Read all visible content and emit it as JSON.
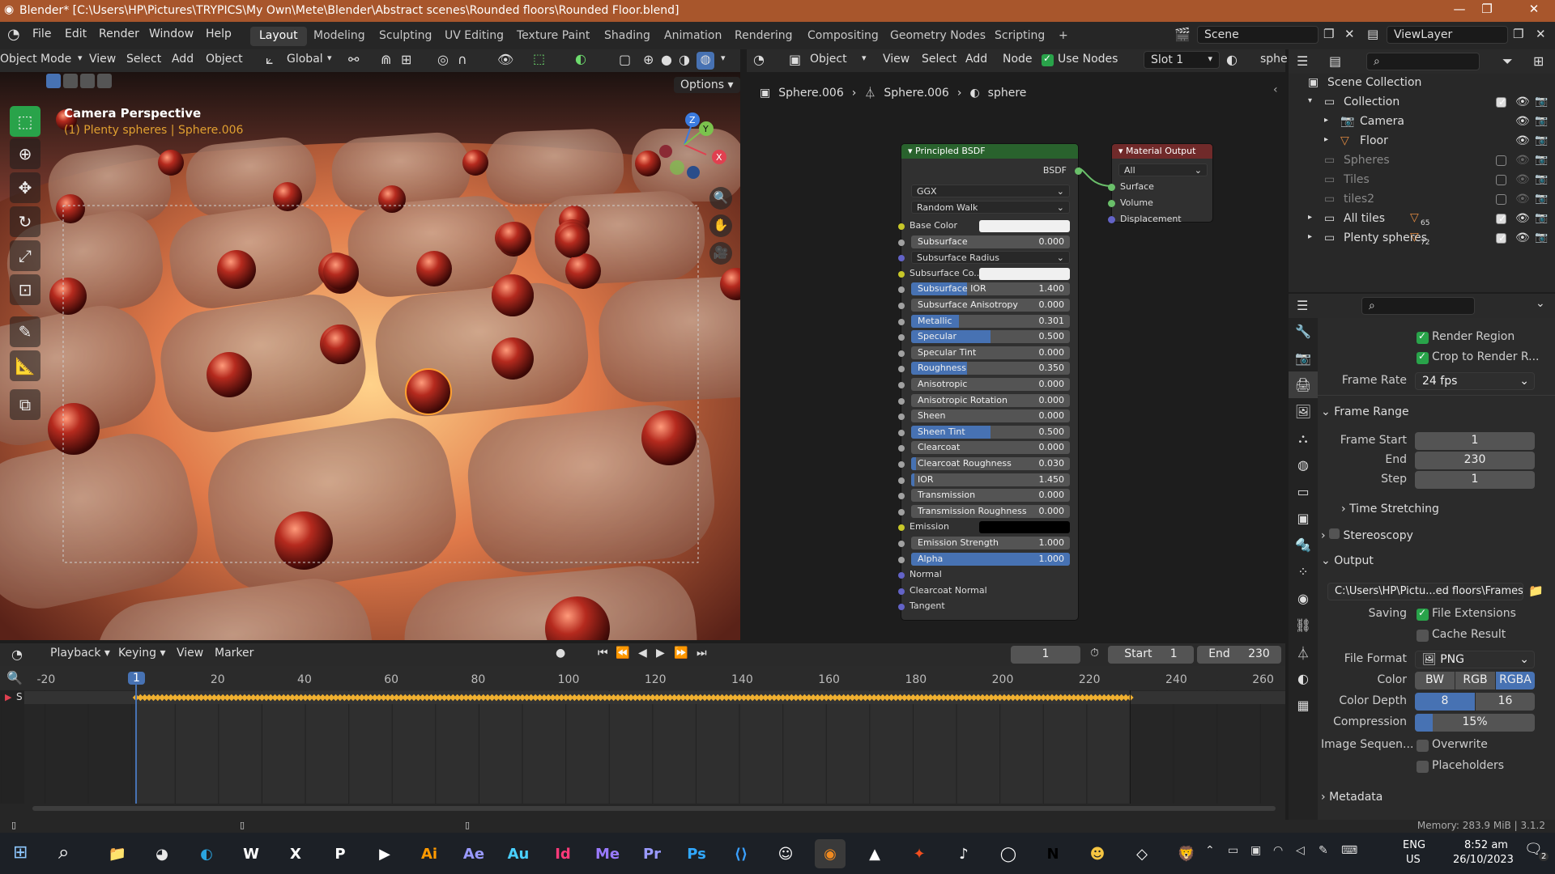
{
  "titlebar": {
    "title": "Blender* [C:\\Users\\HP\\Pictures\\TRYPICS\\My Own\\Mete\\Blender\\Abstract scenes\\Rounded floors\\Rounded Floor.blend]",
    "minimize": "—",
    "maximize": "❐",
    "close": "✕"
  },
  "menu": [
    "File",
    "Edit",
    "Render",
    "Window",
    "Help"
  ],
  "workspaces": [
    "Layout",
    "Modeling",
    "Sculpting",
    "UV Editing",
    "Texture Paint",
    "Shading",
    "Animation",
    "Rendering",
    "Compositing",
    "Geometry Nodes",
    "Scripting",
    "+"
  ],
  "scene_name": "Scene",
  "view_layer": "ViewLayer",
  "viewport": {
    "mode": "Object Mode",
    "menus": [
      "View",
      "Select",
      "Add",
      "Object"
    ],
    "transform": "Global",
    "options": "Options",
    "overlay_title": "Camera Perspective",
    "overlay_sub": "(1) Plenty spheres | Sphere.006",
    "gizmo": {
      "x": "X",
      "y": "Y",
      "z": "Z"
    }
  },
  "node_editor": {
    "object_type": "Object",
    "menus": [
      "View",
      "Select",
      "Add",
      "Node"
    ],
    "use_nodes": "Use Nodes",
    "slot": "Slot 1",
    "material_short": "sphe",
    "breadcrumb": [
      "Sphere.006",
      "Sphere.006",
      "sphere"
    ],
    "bsdf_title": "Principled BSDF",
    "bsdf_out": "BSDF",
    "distribution": "GGX",
    "subsurface_method": "Random Walk",
    "subsurface_radius": "Subsurface Radius",
    "params": [
      {
        "label": "Base Color",
        "type": "color",
        "color": "#f0f0f0",
        "sock": "#c7c729"
      },
      {
        "label": "Subsurface",
        "value": "0.000",
        "fill": 0,
        "sock": "#a1a1a1"
      },
      {
        "label": "Subsurface Radius",
        "type": "drop",
        "sock": "#6363c7"
      },
      {
        "label": "Subsurface Co...",
        "type": "color",
        "color": "#f0f0f0",
        "sock": "#c7c729"
      },
      {
        "label": "Subsurface IOR",
        "value": "1.400",
        "fill": 0.35,
        "sock": "#a1a1a1"
      },
      {
        "label": "Subsurface Anisotropy",
        "value": "0.000",
        "fill": 0,
        "sock": "#a1a1a1"
      },
      {
        "label": "Metallic",
        "value": "0.301",
        "fill": 0.301,
        "sock": "#a1a1a1"
      },
      {
        "label": "Specular",
        "value": "0.500",
        "fill": 0.5,
        "sock": "#a1a1a1"
      },
      {
        "label": "Specular Tint",
        "value": "0.000",
        "fill": 0,
        "sock": "#a1a1a1"
      },
      {
        "label": "Roughness",
        "value": "0.350",
        "fill": 0.35,
        "sock": "#a1a1a1"
      },
      {
        "label": "Anisotropic",
        "value": "0.000",
        "fill": 0,
        "sock": "#a1a1a1"
      },
      {
        "label": "Anisotropic Rotation",
        "value": "0.000",
        "fill": 0,
        "sock": "#a1a1a1"
      },
      {
        "label": "Sheen",
        "value": "0.000",
        "fill": 0,
        "sock": "#a1a1a1"
      },
      {
        "label": "Sheen Tint",
        "value": "0.500",
        "fill": 0.5,
        "sock": "#a1a1a1"
      },
      {
        "label": "Clearcoat",
        "value": "0.000",
        "fill": 0,
        "sock": "#a1a1a1"
      },
      {
        "label": "Clearcoat Roughness",
        "value": "0.030",
        "fill": 0.03,
        "sock": "#a1a1a1"
      },
      {
        "label": "IOR",
        "value": "1.450",
        "fill": 0.02,
        "sock": "#a1a1a1"
      },
      {
        "label": "Transmission",
        "value": "0.000",
        "fill": 0,
        "sock": "#a1a1a1"
      },
      {
        "label": "Transmission Roughness",
        "value": "0.000",
        "fill": 0,
        "sock": "#a1a1a1"
      },
      {
        "label": "Emission",
        "type": "color",
        "color": "#000000",
        "sock": "#c7c729"
      },
      {
        "label": "Emission Strength",
        "value": "1.000",
        "fill": 0,
        "sock": "#a1a1a1"
      },
      {
        "label": "Alpha",
        "value": "1.000",
        "fill": 1,
        "sock": "#a1a1a1"
      },
      {
        "label": "Normal",
        "type": "plain",
        "sock": "#6363c7"
      },
      {
        "label": "Clearcoat Normal",
        "type": "plain",
        "sock": "#6363c7"
      },
      {
        "label": "Tangent",
        "type": "plain",
        "sock": "#6363c7"
      }
    ],
    "output_title": "Material Output",
    "output_target": "All",
    "output_inputs": [
      "Surface",
      "Volume",
      "Displacement"
    ]
  },
  "outliner": {
    "rows": [
      {
        "label": "Scene Collection",
        "indent": 0,
        "dim": false,
        "checkbox": false
      },
      {
        "label": "Collection",
        "indent": 1,
        "dim": false,
        "checkbox": true,
        "expanded": true
      },
      {
        "label": "Camera",
        "indent": 2,
        "dim": false,
        "checkbox": false
      },
      {
        "label": "Floor",
        "indent": 2,
        "dim": false,
        "checkbox": false
      },
      {
        "label": "Spheres",
        "indent": 1,
        "dim": true,
        "checkbox": true
      },
      {
        "label": "Tiles",
        "indent": 1,
        "dim": true,
        "checkbox": true
      },
      {
        "label": "tiles2",
        "indent": 1,
        "dim": true,
        "checkbox": true
      },
      {
        "label": "All tiles",
        "indent": 1,
        "dim": false,
        "checkbox": true,
        "badge": "65"
      },
      {
        "label": "Plenty spheres",
        "indent": 1,
        "dim": false,
        "checkbox": true,
        "badge": "72"
      }
    ]
  },
  "properties": {
    "render_region": "Render Region",
    "crop": "Crop to Render R...",
    "frame_rate_label": "Frame Rate",
    "frame_rate": "24 fps",
    "frame_range": "Frame Range",
    "frame_start_label": "Frame Start",
    "frame_start": "1",
    "end_label": "End",
    "end": "230",
    "step_label": "Step",
    "step": "1",
    "time_stretching": "Time Stretching",
    "stereoscopy": "Stereoscopy",
    "output": "Output",
    "output_path": "C:\\Users\\HP\\Pictu...ed floors\\Frames\\",
    "saving_label": "Saving",
    "file_extensions": "File Extensions",
    "cache_result": "Cache Result",
    "file_format_label": "File Format",
    "file_format": "PNG",
    "color_label": "Color",
    "color_opts": [
      "BW",
      "RGB",
      "RGBA"
    ],
    "color_depth_label": "Color Depth",
    "depth_opts": [
      "8",
      "16"
    ],
    "compression_label": "Compression",
    "compression": "15%",
    "compression_fraction": 0.15,
    "image_seq_label": "Image Sequen...",
    "overwrite": "Overwrite",
    "placeholders": "Placeholders",
    "metadata": "Metadata"
  },
  "timeline": {
    "menus": [
      "Playback",
      "Keying",
      "View",
      "Marker"
    ],
    "current_frame": "1",
    "start_label": "Start",
    "start": "1",
    "end_label": "End",
    "end": "230",
    "ruler": [
      "-20",
      "1",
      "20",
      "40",
      "60",
      "80",
      "100",
      "120",
      "140",
      "160",
      "180",
      "200",
      "220",
      "240",
      "260"
    ],
    "channel": "S",
    "keyframe_count": 230
  },
  "statusbar": {
    "memory": "Memory: 283.9 MiB | 3.1.2"
  },
  "taskbar": {
    "apps": [
      "Explorer",
      "Chrome",
      "Edge",
      "W",
      "X",
      "P",
      "Media",
      "Ai",
      "Ae",
      "Au",
      "Id",
      "Me",
      "Pr",
      "Ps",
      "VS Code",
      "Discord",
      "Blender",
      "VLC",
      "Figma",
      "Music",
      "GitHub",
      "N",
      "Emoji",
      "Unity",
      "Brave"
    ],
    "lang": "ENG",
    "region": "US",
    "time": "8:52 am",
    "date": "26/10/2023",
    "notif": "2"
  },
  "colors": {
    "accent": "#4772b3",
    "active_tool": "#29a34a",
    "title": "#a8562c",
    "bsdf_header": "#29622d",
    "output_header": "#702a2a",
    "keyframe": "#f0b030"
  }
}
